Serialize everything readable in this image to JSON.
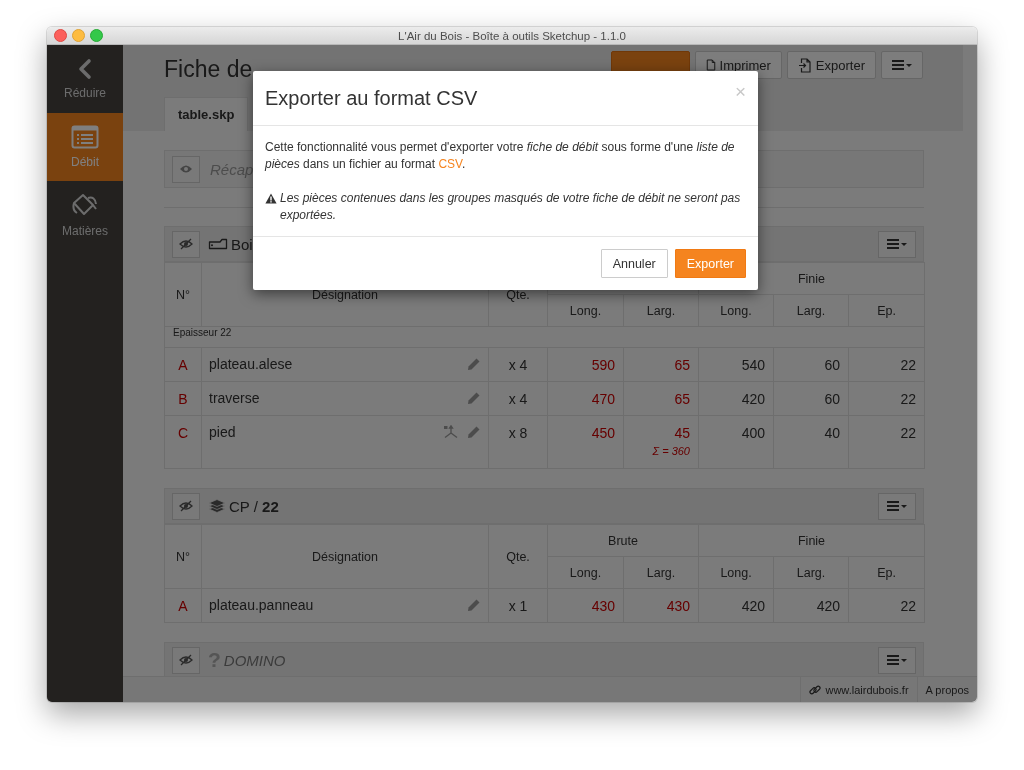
{
  "window": {
    "title": "L'Air du Bois - Boîte à outils Sketchup - 1.1.0"
  },
  "sidebar": {
    "items": [
      {
        "kind": "collapse",
        "label": "Réduire",
        "selected": false
      },
      {
        "kind": "sheet",
        "label": "Débit",
        "selected": true
      },
      {
        "kind": "materials",
        "label": "Matières",
        "selected": false
      }
    ]
  },
  "header": {
    "title": "Fiche de",
    "buttons": [
      {
        "kind": "generate"
      },
      {
        "kind": "print",
        "label": "Imprimer"
      },
      {
        "kind": "export",
        "label": "Exporter"
      },
      {
        "kind": "menu"
      }
    ]
  },
  "tabs": [
    {
      "label": "table.skp",
      "selected": true
    }
  ],
  "summary": {
    "label": "Récap",
    "hidden": true
  },
  "groups": [
    {
      "kind": "wood",
      "title": "Boi",
      "hidden": false,
      "head": {
        "number": "N°",
        "designation": "Désignation",
        "quantity": "Qte.",
        "finished": "Finie",
        "sub": [
          "Long.",
          "Larg.",
          "Long.",
          "Larg.",
          "Ep."
        ]
      },
      "sections": [
        {
          "label": "Epaisseur 22",
          "rows": [
            {
              "id": "A",
              "name": "plateau.alese",
              "qty": "x 4",
              "raw": [
                "590",
                "65"
              ],
              "finished": [
                "540",
                "60",
                "22"
              ],
              "axes": false
            },
            {
              "id": "B",
              "name": "traverse",
              "qty": "x 4",
              "raw": [
                "470",
                "65"
              ],
              "finished": [
                "420",
                "60",
                "22"
              ],
              "axes": false
            },
            {
              "id": "C",
              "name": "pied",
              "qty": "x 8",
              "raw": [
                "450",
                "45"
              ],
              "finished": [
                "400",
                "40",
                "22"
              ],
              "axes": true,
              "sum": "Σ = 360"
            }
          ]
        }
      ]
    },
    {
      "kind": "sheet",
      "title": "CP / **22**",
      "hidden": false,
      "head": {
        "number": "N°",
        "designation": "Désignation",
        "quantity": "Qte.",
        "raw": "Brute",
        "finished": "Finie",
        "sub": [
          "Long.",
          "Larg.",
          "Long.",
          "Larg.",
          "Ep."
        ]
      },
      "sections": [
        {
          "rows": [
            {
              "id": "A",
              "name": "plateau.panneau",
              "qty": "x 1",
              "raw": [
                "430",
                "430"
              ],
              "finished": [
                "420",
                "420",
                "22"
              ],
              "axes": false
            }
          ]
        }
      ]
    },
    {
      "kind": "unknown",
      "mark": "?",
      "title": "DOMINO",
      "hidden": false
    }
  ],
  "modal": {
    "title": "Exporter au format CSV",
    "close": "×",
    "text_before": "Cette fonctionnalité vous permet d'exporter votre *fiche de débit* sous forme d'une *liste de pièces* dans un fichier au format ",
    "link": "CSV",
    "text_after": ".",
    "warning": "Les pièces contenues dans les groupes masqués de votre fiche de débit ne seront pas exportées.",
    "buttons": [
      {
        "kind": "default",
        "label": "Annuler"
      },
      {
        "kind": "primary",
        "label": "Exporter"
      }
    ]
  },
  "status_bar": {
    "links": [
      {
        "kind": "site",
        "label": "www.lairdubois.fr"
      },
      {
        "kind": "about",
        "label": "A propos"
      }
    ]
  }
}
